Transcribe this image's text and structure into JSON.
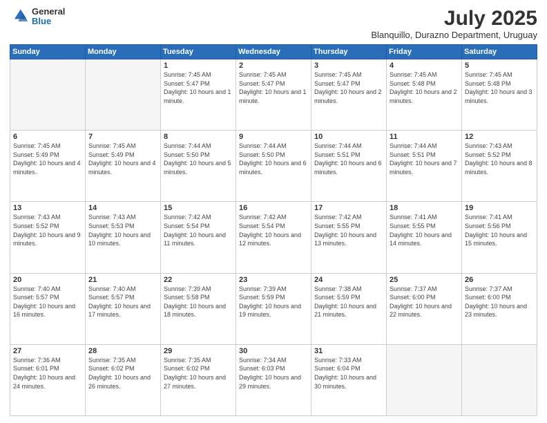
{
  "header": {
    "logo_general": "General",
    "logo_blue": "Blue",
    "month_year": "July 2025",
    "location": "Blanquillo, Durazno Department, Uruguay"
  },
  "days_of_week": [
    "Sunday",
    "Monday",
    "Tuesday",
    "Wednesday",
    "Thursday",
    "Friday",
    "Saturday"
  ],
  "weeks": [
    [
      {
        "day": "",
        "info": ""
      },
      {
        "day": "",
        "info": ""
      },
      {
        "day": "1",
        "info": "Sunrise: 7:45 AM\nSunset: 5:47 PM\nDaylight: 10 hours and 1 minute."
      },
      {
        "day": "2",
        "info": "Sunrise: 7:45 AM\nSunset: 5:47 PM\nDaylight: 10 hours and 1 minute."
      },
      {
        "day": "3",
        "info": "Sunrise: 7:45 AM\nSunset: 5:47 PM\nDaylight: 10 hours and 2 minutes."
      },
      {
        "day": "4",
        "info": "Sunrise: 7:45 AM\nSunset: 5:48 PM\nDaylight: 10 hours and 2 minutes."
      },
      {
        "day": "5",
        "info": "Sunrise: 7:45 AM\nSunset: 5:48 PM\nDaylight: 10 hours and 3 minutes."
      }
    ],
    [
      {
        "day": "6",
        "info": "Sunrise: 7:45 AM\nSunset: 5:49 PM\nDaylight: 10 hours and 4 minutes."
      },
      {
        "day": "7",
        "info": "Sunrise: 7:45 AM\nSunset: 5:49 PM\nDaylight: 10 hours and 4 minutes."
      },
      {
        "day": "8",
        "info": "Sunrise: 7:44 AM\nSunset: 5:50 PM\nDaylight: 10 hours and 5 minutes."
      },
      {
        "day": "9",
        "info": "Sunrise: 7:44 AM\nSunset: 5:50 PM\nDaylight: 10 hours and 6 minutes."
      },
      {
        "day": "10",
        "info": "Sunrise: 7:44 AM\nSunset: 5:51 PM\nDaylight: 10 hours and 6 minutes."
      },
      {
        "day": "11",
        "info": "Sunrise: 7:44 AM\nSunset: 5:51 PM\nDaylight: 10 hours and 7 minutes."
      },
      {
        "day": "12",
        "info": "Sunrise: 7:43 AM\nSunset: 5:52 PM\nDaylight: 10 hours and 8 minutes."
      }
    ],
    [
      {
        "day": "13",
        "info": "Sunrise: 7:43 AM\nSunset: 5:52 PM\nDaylight: 10 hours and 9 minutes."
      },
      {
        "day": "14",
        "info": "Sunrise: 7:43 AM\nSunset: 5:53 PM\nDaylight: 10 hours and 10 minutes."
      },
      {
        "day": "15",
        "info": "Sunrise: 7:42 AM\nSunset: 5:54 PM\nDaylight: 10 hours and 11 minutes."
      },
      {
        "day": "16",
        "info": "Sunrise: 7:42 AM\nSunset: 5:54 PM\nDaylight: 10 hours and 12 minutes."
      },
      {
        "day": "17",
        "info": "Sunrise: 7:42 AM\nSunset: 5:55 PM\nDaylight: 10 hours and 13 minutes."
      },
      {
        "day": "18",
        "info": "Sunrise: 7:41 AM\nSunset: 5:55 PM\nDaylight: 10 hours and 14 minutes."
      },
      {
        "day": "19",
        "info": "Sunrise: 7:41 AM\nSunset: 5:56 PM\nDaylight: 10 hours and 15 minutes."
      }
    ],
    [
      {
        "day": "20",
        "info": "Sunrise: 7:40 AM\nSunset: 5:57 PM\nDaylight: 10 hours and 16 minutes."
      },
      {
        "day": "21",
        "info": "Sunrise: 7:40 AM\nSunset: 5:57 PM\nDaylight: 10 hours and 17 minutes."
      },
      {
        "day": "22",
        "info": "Sunrise: 7:39 AM\nSunset: 5:58 PM\nDaylight: 10 hours and 18 minutes."
      },
      {
        "day": "23",
        "info": "Sunrise: 7:39 AM\nSunset: 5:59 PM\nDaylight: 10 hours and 19 minutes."
      },
      {
        "day": "24",
        "info": "Sunrise: 7:38 AM\nSunset: 5:59 PM\nDaylight: 10 hours and 21 minutes."
      },
      {
        "day": "25",
        "info": "Sunrise: 7:37 AM\nSunset: 6:00 PM\nDaylight: 10 hours and 22 minutes."
      },
      {
        "day": "26",
        "info": "Sunrise: 7:37 AM\nSunset: 6:00 PM\nDaylight: 10 hours and 23 minutes."
      }
    ],
    [
      {
        "day": "27",
        "info": "Sunrise: 7:36 AM\nSunset: 6:01 PM\nDaylight: 10 hours and 24 minutes."
      },
      {
        "day": "28",
        "info": "Sunrise: 7:35 AM\nSunset: 6:02 PM\nDaylight: 10 hours and 26 minutes."
      },
      {
        "day": "29",
        "info": "Sunrise: 7:35 AM\nSunset: 6:02 PM\nDaylight: 10 hours and 27 minutes."
      },
      {
        "day": "30",
        "info": "Sunrise: 7:34 AM\nSunset: 6:03 PM\nDaylight: 10 hours and 29 minutes."
      },
      {
        "day": "31",
        "info": "Sunrise: 7:33 AM\nSunset: 6:04 PM\nDaylight: 10 hours and 30 minutes."
      },
      {
        "day": "",
        "info": ""
      },
      {
        "day": "",
        "info": ""
      }
    ]
  ]
}
